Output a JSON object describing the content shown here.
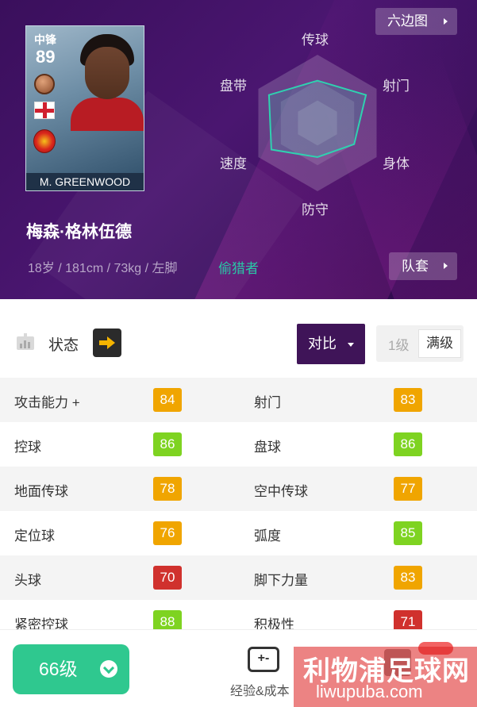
{
  "hero": {
    "card": {
      "position": "中锋",
      "overall": "89",
      "card_name": "M. GREENWOOD"
    },
    "player_name": "梅森·格林伍德",
    "meta": "18岁 / 181cm / 73kg / 左脚",
    "play_style": "偷猎者",
    "hexagon_button": "六边图",
    "squad_button": "队套",
    "radar": {
      "axes": [
        "传球",
        "射门",
        "身体",
        "防守",
        "速度",
        "盘带"
      ],
      "values": [
        0.62,
        0.82,
        0.62,
        0.5,
        0.78,
        0.82
      ],
      "line_color": "#2fd1b0"
    }
  },
  "toolbar": {
    "status_label": "状态",
    "compare_label": "对比",
    "level_option_1": "1级",
    "level_option_max": "满级"
  },
  "stats": [
    {
      "left_name": "攻击能力 +",
      "left_value": "84",
      "left_color": "#f0a500",
      "right_name": "射门",
      "right_value": "83",
      "right_color": "#f0a500"
    },
    {
      "left_name": "控球",
      "left_value": "86",
      "left_color": "#7ed321",
      "right_name": "盘球",
      "right_value": "86",
      "right_color": "#7ed321"
    },
    {
      "left_name": "地面传球",
      "left_value": "78",
      "left_color": "#f0a500",
      "right_name": "空中传球",
      "right_value": "77",
      "right_color": "#f0a500"
    },
    {
      "left_name": "定位球",
      "left_value": "76",
      "left_color": "#f0a500",
      "right_name": "弧度",
      "right_value": "85",
      "right_color": "#7ed321"
    },
    {
      "left_name": "头球",
      "left_value": "70",
      "left_color": "#d0312d",
      "right_name": "脚下力量",
      "right_value": "83",
      "right_color": "#f0a500"
    },
    {
      "left_name": "紧密控球",
      "left_value": "88",
      "left_color": "#7ed321",
      "right_name": "积极性",
      "right_value": "71",
      "right_color": "#d0312d"
    }
  ],
  "bottom": {
    "level_button": "66级",
    "exp_icon_text": "+-",
    "exp_label": "经验&成本"
  },
  "watermark": {
    "title": "利物浦足球网",
    "url": "liwupuba.com"
  }
}
